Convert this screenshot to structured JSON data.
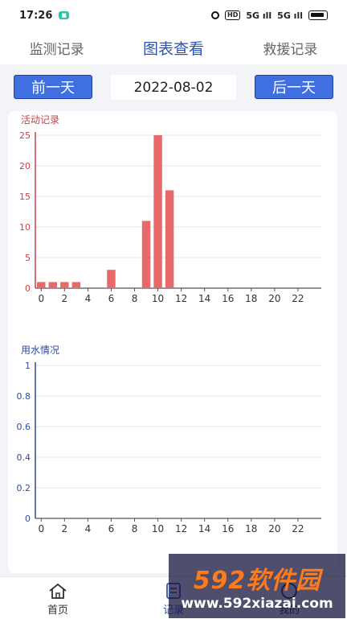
{
  "status": {
    "time": "17:26",
    "signal1": "5G ıll",
    "signal2": "5G ıll",
    "hd": "HD"
  },
  "tabs": [
    {
      "label": "监测记录",
      "active": false
    },
    {
      "label": "图表查看",
      "active": true
    },
    {
      "label": "救援记录",
      "active": false
    }
  ],
  "date_nav": {
    "prev_label": "前一天",
    "date": "2022-08-02",
    "next_label": "后一天"
  },
  "chart_data": [
    {
      "type": "bar",
      "title": "活动记录",
      "x": [
        0,
        1,
        2,
        3,
        4,
        5,
        6,
        7,
        8,
        9,
        10,
        11,
        12,
        13,
        14,
        15,
        16,
        17,
        18,
        19,
        20,
        21,
        22,
        23
      ],
      "values": [
        1,
        1,
        1,
        1,
        0,
        0,
        3,
        0,
        0,
        11,
        25,
        16,
        0,
        0,
        0,
        0,
        0,
        0,
        0,
        0,
        0,
        0,
        0,
        0
      ],
      "xticks": [
        0,
        2,
        4,
        6,
        8,
        10,
        12,
        14,
        16,
        18,
        20,
        22
      ],
      "ylim": [
        0,
        25
      ],
      "yticks": [
        0,
        5,
        10,
        15,
        20,
        25
      ],
      "color": "#e8696c",
      "grid": true
    },
    {
      "type": "bar",
      "title": "用水情况",
      "x": [
        0,
        1,
        2,
        3,
        4,
        5,
        6,
        7,
        8,
        9,
        10,
        11,
        12,
        13,
        14,
        15,
        16,
        17,
        18,
        19,
        20,
        21,
        22,
        23
      ],
      "values": [
        0,
        0,
        0,
        0,
        0,
        0,
        0,
        0,
        0,
        0,
        0,
        0,
        0,
        0,
        0,
        0,
        0,
        0,
        0,
        0,
        0,
        0,
        0,
        0
      ],
      "xticks": [
        0,
        2,
        4,
        6,
        8,
        10,
        12,
        14,
        16,
        18,
        20,
        22
      ],
      "ylim": [
        0,
        1
      ],
      "yticks": [
        0,
        0.2,
        0.4,
        0.6,
        0.8,
        1
      ],
      "color": "#3a5bbf",
      "grid": true
    }
  ],
  "bottom_nav": [
    {
      "label": "首页",
      "icon": "home-icon",
      "active": false
    },
    {
      "label": "记录",
      "icon": "record-icon",
      "active": true
    },
    {
      "label": "我的",
      "icon": "user-icon",
      "active": false
    }
  ],
  "watermark": {
    "brand": "592软件园",
    "url": "www.592xiazai.com"
  }
}
